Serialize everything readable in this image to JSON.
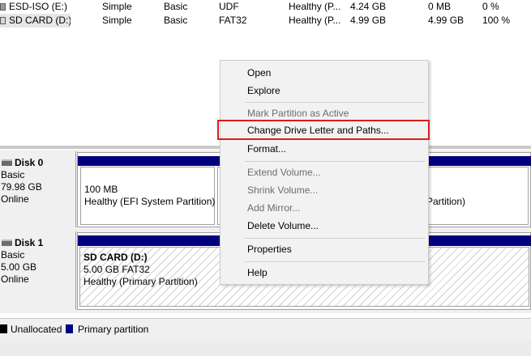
{
  "volume_list": {
    "rows": [
      {
        "name": "ESD-ISO (E:)",
        "layout": "Simple",
        "type": "Basic",
        "file_system": "UDF",
        "status": "Healthy (P...",
        "capacity": "4.24 GB",
        "free_space": "0 MB",
        "percent_free": "0 %",
        "icon": "optical-drive-icon"
      },
      {
        "name": "SD CARD (D:)",
        "layout": "Simple",
        "type": "Basic",
        "file_system": "FAT32",
        "status": "Healthy (P...",
        "capacity": "4.99 GB",
        "free_space": "4.99 GB",
        "percent_free": "100 %",
        "icon": "sd-card-drive-icon"
      }
    ]
  },
  "disks": [
    {
      "title": "Disk 0",
      "type": "Basic",
      "size": "79.98 GB",
      "status": "Online",
      "partitions": [
        {
          "size": "100 MB",
          "status": "Healthy (EFI System Partition)"
        },
        {
          "status_tail": "a Partition)"
        }
      ]
    },
    {
      "title": "Disk 1",
      "type": "Basic",
      "size": "5.00 GB",
      "status": "Online",
      "partitions": [
        {
          "name": "SD CARD  (D:)",
          "size_fs": "5.00 GB FAT32",
          "status": "Healthy (Primary Partition)"
        }
      ]
    }
  ],
  "legend": {
    "unallocated": "Unallocated",
    "primary": "Primary partition",
    "colors": {
      "unallocated": "#000000",
      "primary": "#00007f"
    }
  },
  "context_menu": {
    "items": [
      {
        "label": "Open",
        "enabled": true
      },
      {
        "label": "Explore",
        "enabled": true
      },
      {
        "label": "Mark Partition as Active",
        "enabled": false
      },
      {
        "label": "Change Drive Letter and Paths...",
        "enabled": true,
        "highlighted": true
      },
      {
        "label": "Format...",
        "enabled": true
      },
      {
        "label": "Extend Volume...",
        "enabled": false
      },
      {
        "label": "Shrink Volume...",
        "enabled": false
      },
      {
        "label": "Add Mirror...",
        "enabled": false
      },
      {
        "label": "Delete Volume...",
        "enabled": true
      },
      {
        "label": "Properties",
        "enabled": true
      },
      {
        "label": "Help",
        "enabled": true
      }
    ],
    "highlight_color": "#d81e1e"
  }
}
